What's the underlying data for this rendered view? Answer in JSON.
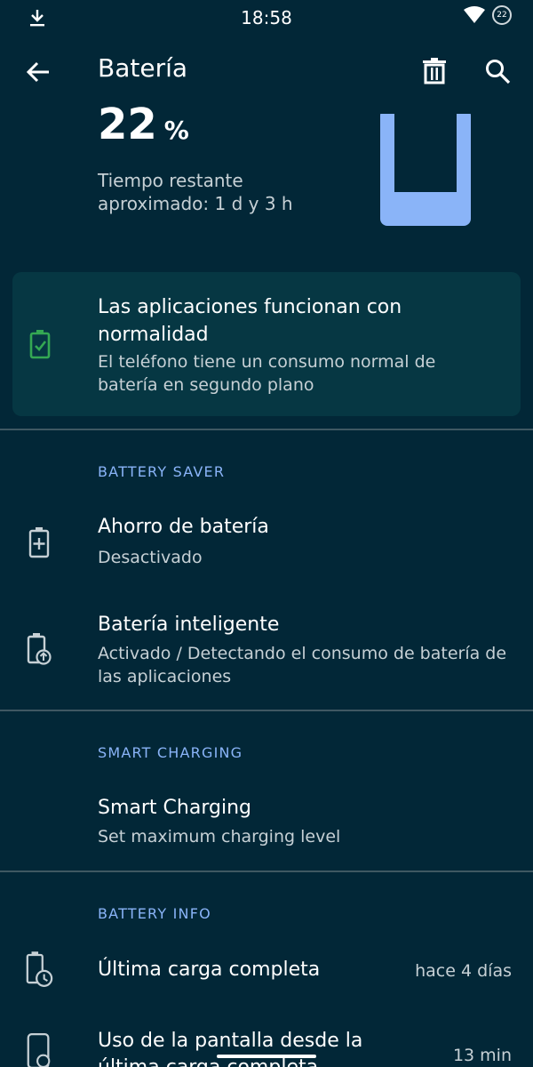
{
  "status_bar": {
    "time": "18:58",
    "battery_text": "22",
    "icons": [
      "download-icon",
      "wifi-icon",
      "battery-circle-icon"
    ]
  },
  "app_bar": {
    "title": "Batería",
    "icons": [
      "back-arrow-icon",
      "trash-icon",
      "search-icon"
    ]
  },
  "battery": {
    "level": "22",
    "unit": "%",
    "remaining": "Tiempo restante aproximado: 1 d y 3 h"
  },
  "tip": {
    "title": "Las aplicaciones funcionan con normalidad",
    "subtitle": "El teléfono tiene un consumo normal de batería en segundo plano",
    "icon": "battery-check-icon"
  },
  "sections": {
    "saver": {
      "header": "BATTERY SAVER",
      "items": [
        {
          "title": "Ahorro de batería",
          "summary": "Desactivado",
          "icon": "battery-plus-icon"
        },
        {
          "title": "Batería inteligente",
          "summary": "Activado / Detectando el consumo de batería de las aplicaciones",
          "icon": "battery-adaptive-icon"
        }
      ]
    },
    "charging": {
      "header": "SMART CHARGING",
      "items": [
        {
          "title": "Smart Charging",
          "summary": "Set maximum charging level"
        }
      ]
    },
    "info": {
      "header": "BATTERY INFO",
      "items": [
        {
          "title": "Última carga completa",
          "value": "hace 4 días",
          "icon": "battery-clock-icon"
        },
        {
          "title": "Uso de la pantalla desde la última carga completa",
          "value": "13 min",
          "icon": "phone-usage-icon"
        }
      ]
    }
  },
  "colors": {
    "background": "#022737",
    "card": "#063743",
    "accent": "#8ab4f8",
    "battery_fill": "#8ab4f8",
    "check_green": "#34a853"
  }
}
